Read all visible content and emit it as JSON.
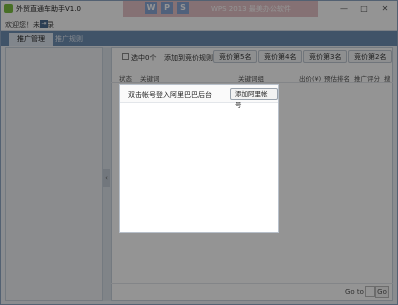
{
  "window": {
    "title": "外贸直通车助手V1.0",
    "banner_tiles": [
      "W",
      "P",
      "S"
    ],
    "banner_text": "WPS 2013 最美办公软件",
    "minimize": "—",
    "maximize": "□",
    "close": "✕"
  },
  "status": {
    "label": "欢迎您！未登录",
    "icon": "logout-icon"
  },
  "tabs": [
    {
      "label": "推广管理",
      "active": true
    },
    {
      "label": "推广规则",
      "active": false
    }
  ],
  "toolbar": {
    "select_all": "选中0个",
    "add_rules": "添加到竞价规则：",
    "buttons": [
      "竞价第5名",
      "竞价第4名",
      "竞价第3名",
      "竞价第2名"
    ]
  },
  "table": {
    "headers": [
      "状态",
      "关键词",
      "关键词组",
      "出价(¥)",
      "预估排名",
      "推广评分",
      "搜"
    ]
  },
  "pagination": {
    "goto_label": "Go to",
    "goto_button": "Go"
  },
  "modal": {
    "title": "双击帐号登入阿里巴巴后台",
    "add_button": "添加阿里帐号"
  },
  "colors": {
    "tabbar": "#6f8fb3",
    "overlay": "rgba(0,0,0,0.42)"
  }
}
